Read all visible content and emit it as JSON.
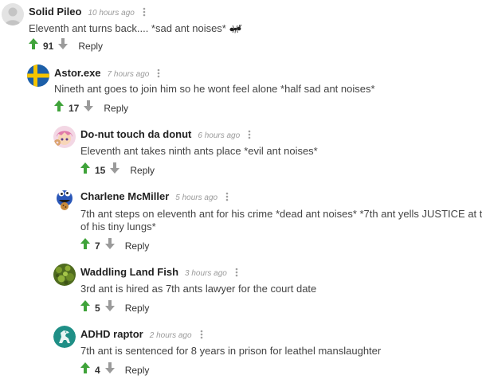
{
  "comments": [
    {
      "author": "Solid Pileo",
      "time": "10 hours ago",
      "text": "Eleventh ant turns back.... *sad ant noises*",
      "score": "91",
      "reply_label": "Reply"
    },
    {
      "author": "Astor.exe",
      "time": "7 hours ago",
      "text": "Nineth ant goes to join him so he wont feel alone *half sad ant noises*",
      "score": "17",
      "reply_label": "Reply"
    },
    {
      "author": "Do-nut touch da donut",
      "time": "6 hours ago",
      "text": "Eleventh ant takes ninth ants place *evil ant noises*",
      "score": "15",
      "reply_label": "Reply"
    },
    {
      "author": "Charlene McMiller",
      "time": "5 hours ago",
      "text_line1": "7th ant steps on eleventh ant for his crime *dead ant noises* *7th ant yells JUSTICE at t",
      "text_line2": "of his tiny lungs*",
      "score": "7",
      "reply_label": "Reply"
    },
    {
      "author": "Waddling Land Fish",
      "time": "3 hours ago",
      "text": "3rd ant is hired as 7th ants lawyer for the court date",
      "score": "5",
      "reply_label": "Reply"
    },
    {
      "author": "ADHD raptor",
      "time": "2 hours ago",
      "text": "7th ant is sentenced for 8 years in prison for leathel manslaughter",
      "score": "4",
      "reply_label": "Reply"
    }
  ],
  "icons": {
    "upvote": "arrow-up-icon",
    "downvote": "arrow-down-icon",
    "more": "more-vertical-icon",
    "emoji": "ant-icon"
  },
  "colors": {
    "upvote": "#3fa33a",
    "downvote": "#9b9b9b",
    "time": "#9a9a9a"
  }
}
